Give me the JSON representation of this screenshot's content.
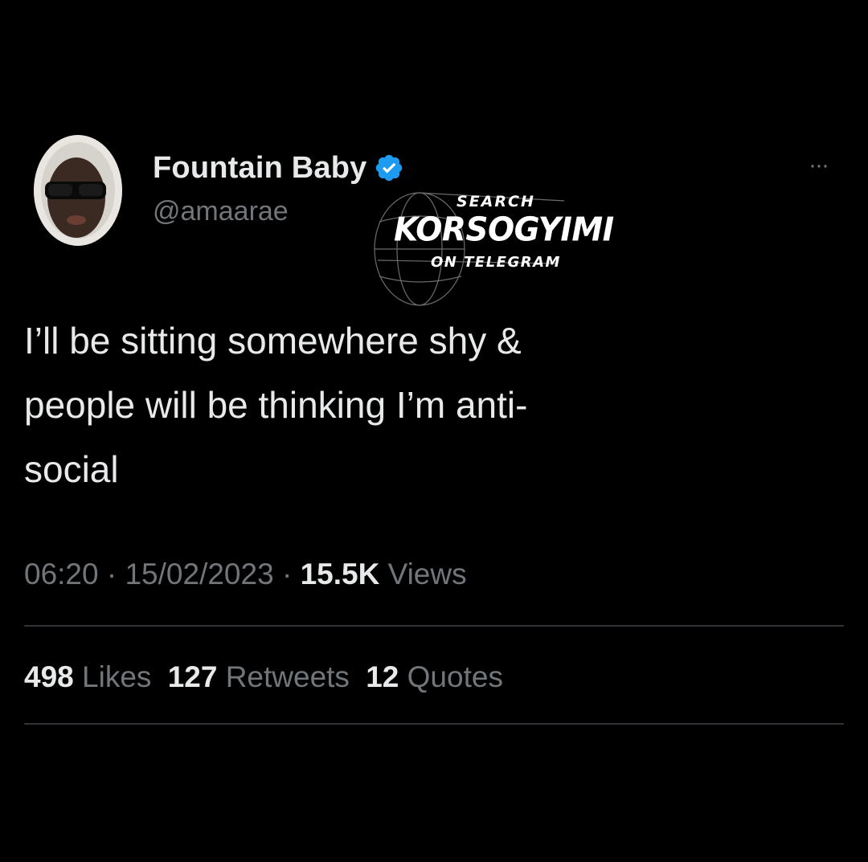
{
  "author": {
    "display_name": "Fountain Baby",
    "handle": "@amaarae",
    "verified": true,
    "verified_color": "#1d9bf0"
  },
  "more_icon": "more-dots-icon",
  "watermark": {
    "line1": "SEARCH",
    "line2": "KORSOGYIMI",
    "line3": "ON TELEGRAM"
  },
  "tweet": {
    "text": "I’ll be sitting somewhere shy &\npeople will be thinking I’m anti-\nsocial"
  },
  "meta": {
    "time": "06:20",
    "separator": " · ",
    "date": "15/02/2023",
    "views_count": "15.5K",
    "views_label": "Views"
  },
  "stats": {
    "likes_count": "498",
    "likes_label": "Likes",
    "retweets_count": "127",
    "retweets_label": "Retweets",
    "quotes_count": "12",
    "quotes_label": "Quotes"
  },
  "colors": {
    "background": "#000000",
    "text_primary": "#e7e9ea",
    "text_secondary": "#71767b",
    "divider": "#2f3336"
  }
}
